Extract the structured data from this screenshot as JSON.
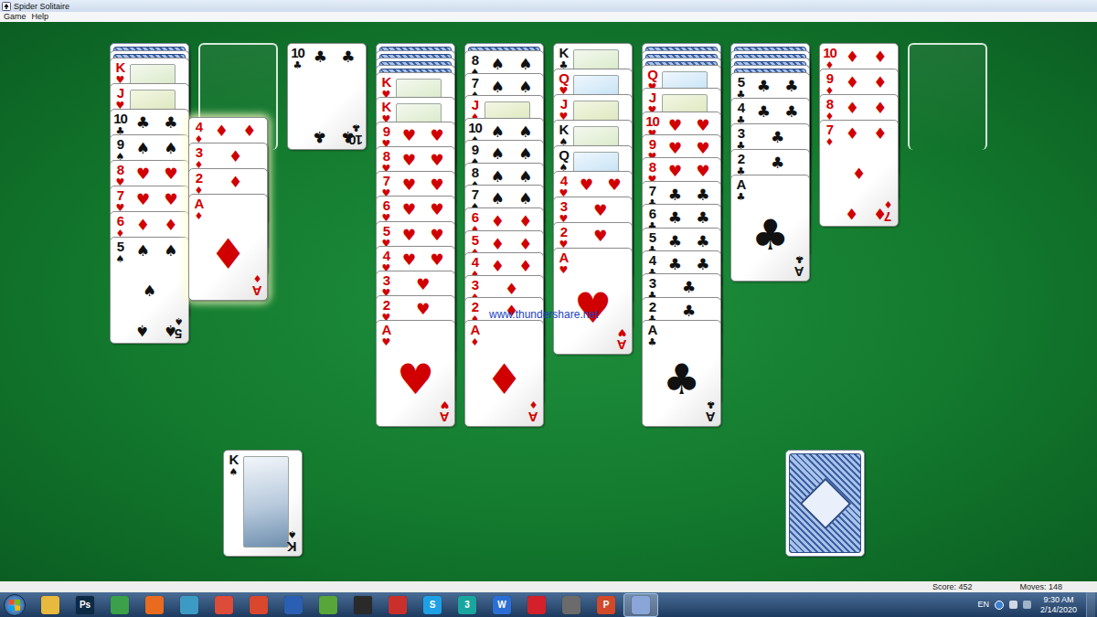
{
  "window": {
    "title": "Spider Solitaire"
  },
  "menu": [
    "Game",
    "Help"
  ],
  "tableau": [
    {
      "face_down": 2,
      "cards": [
        {
          "rank": "K",
          "suit": "♥"
        },
        {
          "rank": "J",
          "suit": "♥"
        },
        {
          "rank": "10",
          "suit": "♣"
        },
        {
          "rank": "9",
          "suit": "♠"
        },
        {
          "rank": "8",
          "suit": "♥"
        },
        {
          "rank": "7",
          "suit": "♥"
        },
        {
          "rank": "6",
          "suit": "♦"
        },
        {
          "rank": "5",
          "suit": "♠"
        }
      ]
    },
    {
      "face_down": 0,
      "cards": []
    },
    {
      "face_down": 0,
      "cards": [
        {
          "rank": "10",
          "suit": "♣"
        }
      ]
    },
    {
      "face_down": 4,
      "cards": [
        {
          "rank": "K",
          "suit": "♥"
        },
        {
          "rank": "K",
          "suit": "♥"
        },
        {
          "rank": "9",
          "suit": "♥"
        },
        {
          "rank": "8",
          "suit": "♥"
        },
        {
          "rank": "7",
          "suit": "♥"
        },
        {
          "rank": "6",
          "suit": "♥"
        },
        {
          "rank": "5",
          "suit": "♥"
        },
        {
          "rank": "4",
          "suit": "♥"
        },
        {
          "rank": "3",
          "suit": "♥"
        },
        {
          "rank": "2",
          "suit": "♥"
        },
        {
          "rank": "A",
          "suit": "♥"
        }
      ]
    },
    {
      "face_down": 1,
      "cards": [
        {
          "rank": "8",
          "suit": "♠"
        },
        {
          "rank": "7",
          "suit": "♠"
        },
        {
          "rank": "J",
          "suit": "♦"
        },
        {
          "rank": "10",
          "suit": "♠"
        },
        {
          "rank": "9",
          "suit": "♠"
        },
        {
          "rank": "8",
          "suit": "♠"
        },
        {
          "rank": "7",
          "suit": "♠"
        },
        {
          "rank": "6",
          "suit": "♦"
        },
        {
          "rank": "5",
          "suit": "♦"
        },
        {
          "rank": "4",
          "suit": "♦"
        },
        {
          "rank": "3",
          "suit": "♦"
        },
        {
          "rank": "2",
          "suit": "♦"
        },
        {
          "rank": "A",
          "suit": "♦"
        }
      ]
    },
    {
      "face_down": 0,
      "cards": [
        {
          "rank": "K",
          "suit": "♣"
        },
        {
          "rank": "Q",
          "suit": "♥"
        },
        {
          "rank": "J",
          "suit": "♥"
        },
        {
          "rank": "K",
          "suit": "♠"
        },
        {
          "rank": "Q",
          "suit": "♠"
        },
        {
          "rank": "4",
          "suit": "♥"
        },
        {
          "rank": "3",
          "suit": "♥"
        },
        {
          "rank": "2",
          "suit": "♥"
        },
        {
          "rank": "A",
          "suit": "♥"
        }
      ]
    },
    {
      "face_down": 3,
      "cards": [
        {
          "rank": "Q",
          "suit": "♥"
        },
        {
          "rank": "J",
          "suit": "♥"
        },
        {
          "rank": "10",
          "suit": "♥"
        },
        {
          "rank": "9",
          "suit": "♥"
        },
        {
          "rank": "8",
          "suit": "♥"
        },
        {
          "rank": "7",
          "suit": "♣"
        },
        {
          "rank": "6",
          "suit": "♣"
        },
        {
          "rank": "5",
          "suit": "♣"
        },
        {
          "rank": "4",
          "suit": "♣"
        },
        {
          "rank": "3",
          "suit": "♣"
        },
        {
          "rank": "2",
          "suit": "♣"
        },
        {
          "rank": "A",
          "suit": "♣"
        }
      ]
    },
    {
      "face_down": 4,
      "cards": [
        {
          "rank": "5",
          "suit": "♣"
        },
        {
          "rank": "4",
          "suit": "♣"
        },
        {
          "rank": "3",
          "suit": "♣"
        },
        {
          "rank": "2",
          "suit": "♣"
        },
        {
          "rank": "A",
          "suit": "♣"
        }
      ]
    },
    {
      "face_down": 0,
      "cards": [
        {
          "rank": "10",
          "suit": "♦"
        },
        {
          "rank": "9",
          "suit": "♦"
        },
        {
          "rank": "8",
          "suit": "♦"
        },
        {
          "rank": "7",
          "suit": "♦"
        }
      ]
    },
    {
      "face_down": 0,
      "cards": []
    }
  ],
  "dragging": {
    "cards": [
      {
        "rank": "4",
        "suit": "♦"
      },
      {
        "rank": "3",
        "suit": "♦"
      },
      {
        "rank": "2",
        "suit": "♦"
      },
      {
        "rank": "A",
        "suit": "♦"
      }
    ]
  },
  "completed": [
    {
      "rank": "K",
      "suit": "♠"
    }
  ],
  "stock": {
    "piles": 1
  },
  "watermark": "www.thundershare.net",
  "status_bar": {
    "score": "Score: 452",
    "moves": "Moves: 148"
  },
  "taskbar": {
    "apps": [
      {
        "color": "#e7b93d",
        "selected": false
      },
      {
        "label": "Ps",
        "color": "#0d2a45",
        "selected": false
      },
      {
        "color": "#3aa14a",
        "selected": false
      },
      {
        "color": "#e86b1f",
        "selected": false
      },
      {
        "color": "#3c9bc4",
        "selected": false
      },
      {
        "color": "#dd4b39",
        "selected": false
      },
      {
        "color": "#d9472f",
        "selected": false
      },
      {
        "color": "#2b5fb3",
        "selected": false
      },
      {
        "color": "#58a63a",
        "selected": false
      },
      {
        "color": "#2a2a2a",
        "selected": false
      },
      {
        "color": "#c9302c",
        "selected": false
      },
      {
        "label": "S",
        "color": "#1ea0e6",
        "selected": false
      },
      {
        "label": "3",
        "color": "#1aa6a0",
        "selected": false
      },
      {
        "label": "W",
        "color": "#2b6fd6",
        "selected": false
      },
      {
        "color": "#d3202a",
        "selected": false
      },
      {
        "color": "#6b6b6b",
        "selected": false
      },
      {
        "label": "P",
        "color": "#d2492a",
        "selected": false
      },
      {
        "color": "#8aa6d8",
        "selected": true
      }
    ],
    "language": "EN",
    "time": "9:30 AM",
    "date": "2/14/2020"
  }
}
